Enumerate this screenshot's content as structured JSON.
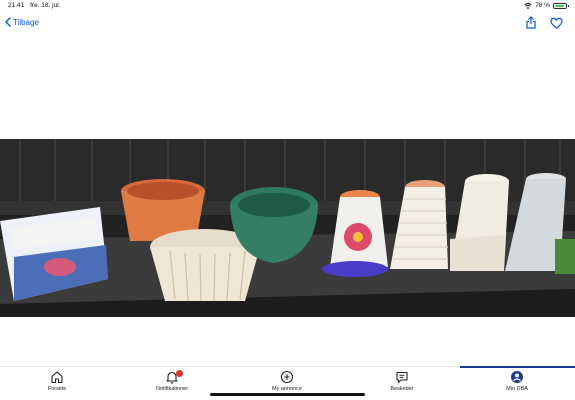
{
  "status_bar": {
    "time": "21.41",
    "date": "fre. 18. jul.",
    "battery_percent": "78 %",
    "battery_level": 0.78
  },
  "nav": {
    "back_label": "Tilbage",
    "icons": [
      "chevron-left-icon",
      "share-icon",
      "heart-icon"
    ],
    "accent_color": "#0a5bd3"
  },
  "photo": {
    "subject": "flower-pots",
    "pots": [
      "blue-white-planter",
      "terracotta-pot",
      "cream-basket-planter",
      "green-pot",
      "painted-flower-pot",
      "ribbed-white-pot",
      "white-pot",
      "white-textured-pot"
    ]
  },
  "tabs": [
    {
      "label": "Forside",
      "icon": "home-icon"
    },
    {
      "label": "Notifikationer",
      "icon": "bell-icon",
      "badge": true
    },
    {
      "label": "My annonce",
      "icon": "plus-circle-icon"
    },
    {
      "label": "Beskeder",
      "icon": "chat-icon"
    },
    {
      "label": "Min DBA",
      "icon": "profile-icon",
      "active": true
    }
  ],
  "colors": {
    "active_tab": "#1b3a8c",
    "badge": "#e0322b"
  }
}
